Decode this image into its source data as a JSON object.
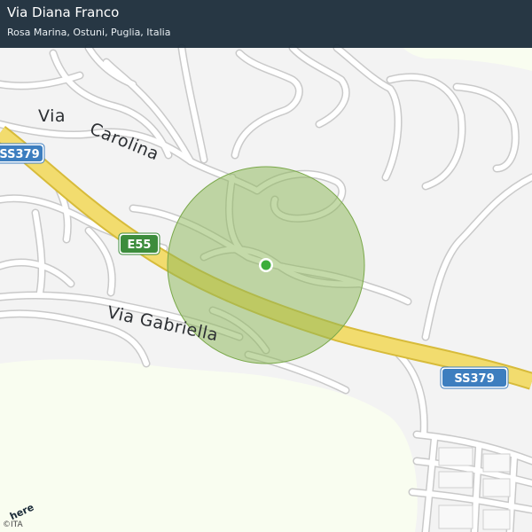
{
  "header": {
    "title": "Via Diana Franco",
    "subtitle": "Rosa Marina, Ostuni, Puglia, Italia"
  },
  "road_labels": {
    "via": "Via",
    "carolina": "Carolina",
    "gabriella": "Via  Gabriella"
  },
  "shields": {
    "ss379_left": "SS379",
    "e55": "E55",
    "ss379_right": "SS379"
  },
  "attribution": {
    "logo": "here",
    "copyright": "©ITA"
  },
  "colors": {
    "land": "#f3f3f3",
    "sea": "#f9fdf0",
    "road": "#ffffff",
    "road_casing": "#c8c8c8",
    "highway": "#f2dc6e",
    "highway_casing": "#d7bb3a",
    "accuracy_circle": "#8db85a",
    "location_dot": "#3cae3c",
    "shield_blue": "#3d7ebf",
    "shield_green": "#3c8c3c",
    "header_bg": "#1a2a38"
  },
  "icons": {
    "location": "location-dot-icon",
    "logo": "here-logo-icon"
  }
}
